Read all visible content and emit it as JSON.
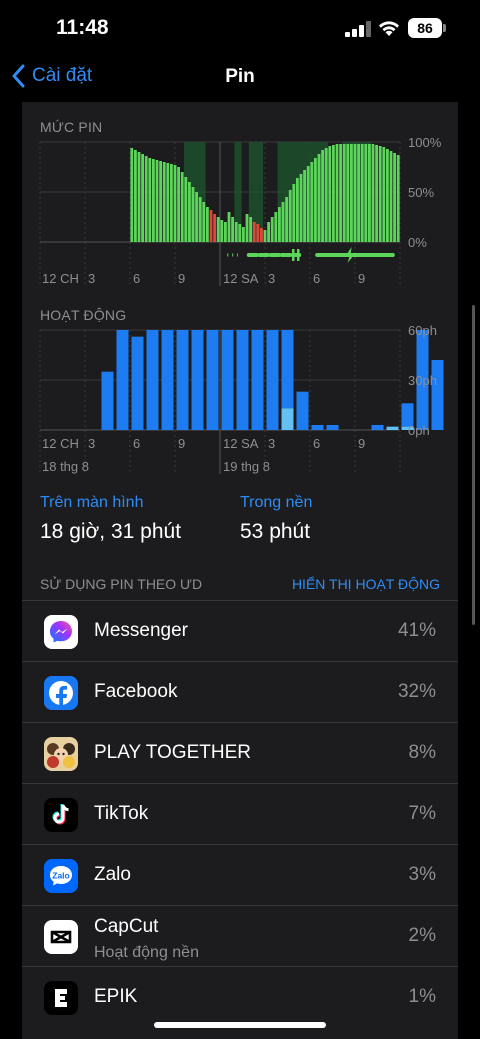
{
  "status": {
    "time": "11:48",
    "battery": "86"
  },
  "nav": {
    "back_label": "Cài đặt",
    "title": "Pin"
  },
  "battery_chart": {
    "section_label": "MỨC PIN",
    "y_ticks": [
      "100%",
      "50%",
      "0%"
    ],
    "x_ticks": [
      "12 CH",
      "3",
      "6",
      "9",
      "12 SA",
      "3",
      "6",
      "9"
    ]
  },
  "activity_chart": {
    "section_label": "HOẠT ĐỘNG",
    "y_ticks": [
      "60ph",
      "30ph",
      "0ph"
    ],
    "x_ticks": [
      "12 CH",
      "3",
      "6",
      "9",
      "12 SA",
      "3",
      "6",
      "9"
    ],
    "date_left": "18 thg 8",
    "date_right": "19 thg 8"
  },
  "chart_data": [
    {
      "type": "bar",
      "title": "MỨC PIN",
      "ylim": [
        0,
        100
      ],
      "y_ticks": [
        "100%",
        "50%",
        "0%"
      ],
      "x_ticks": [
        "12 CH",
        "3",
        "6",
        "9",
        "12 SA",
        "3",
        "6",
        "9"
      ],
      "values": [
        0,
        0,
        0,
        0,
        0,
        0,
        0,
        0,
        0,
        0,
        0,
        0,
        0,
        0,
        0,
        0,
        0,
        0,
        0,
        0,
        0,
        0,
        0,
        0,
        0,
        94,
        92,
        90,
        88,
        86,
        84,
        83,
        82,
        81,
        80,
        79,
        78,
        77,
        75,
        70,
        65,
        60,
        55,
        50,
        45,
        40,
        35,
        32,
        28,
        25,
        22,
        20,
        30,
        25,
        20,
        18,
        15,
        28,
        25,
        20,
        18,
        14,
        12,
        20,
        25,
        30,
        35,
        40,
        45,
        52,
        58,
        64,
        68,
        72,
        76,
        80,
        84,
        88,
        92,
        94,
        96,
        97,
        98,
        98,
        98,
        98,
        98,
        98,
        98,
        98,
        98,
        98,
        98,
        97,
        96,
        95,
        93,
        91,
        89,
        87
      ],
      "red_indices": [
        47,
        48,
        59,
        60,
        61
      ],
      "dark_green_bands": [
        [
          40,
          46
        ],
        [
          54,
          56
        ],
        [
          58,
          62
        ],
        [
          66,
          80
        ],
        [
          84,
          92
        ]
      ],
      "charging_band": [
        52,
        98
      ]
    },
    {
      "type": "bar",
      "title": "HOẠT ĐỘNG",
      "ylim": [
        0,
        60
      ],
      "y_ticks": [
        "60ph",
        "30ph",
        "0ph"
      ],
      "x_ticks": [
        "12 CH",
        "3",
        "6",
        "9",
        "12 SA",
        "3",
        "6",
        "9"
      ],
      "series": [
        {
          "name": "Trên màn hình",
          "values": [
            0,
            0,
            0,
            35,
            60,
            56,
            60,
            60,
            60,
            60,
            60,
            60,
            60,
            60,
            60,
            60,
            23,
            3,
            3,
            0,
            0,
            3,
            1,
            16,
            60,
            42
          ]
        },
        {
          "name": "Trong nền",
          "values": [
            0,
            0,
            0,
            0,
            0,
            0,
            0,
            0,
            0,
            0,
            0,
            0,
            0,
            0,
            0,
            13,
            0,
            0,
            0,
            0,
            0,
            0,
            2,
            2,
            0,
            0
          ]
        }
      ],
      "slot_positions": [
        -2,
        -1,
        0,
        1,
        2,
        3,
        4,
        5,
        6,
        7,
        8,
        9,
        10,
        11,
        12,
        13,
        14,
        15,
        16,
        17,
        18,
        19,
        20,
        21,
        22,
        23
      ]
    }
  ],
  "summary": {
    "screen_label": "Trên màn hình",
    "screen_value": "18 giờ, 31 phút",
    "background_label": "Trong nền",
    "background_value": "53 phút"
  },
  "usage": {
    "header": "SỬ DỤNG PIN THEO ƯD",
    "toggle": "HIỂN THỊ HOẠT ĐỘNG",
    "apps": [
      {
        "name": "Messenger",
        "percent": "41%"
      },
      {
        "name": "Facebook",
        "percent": "32%"
      },
      {
        "name": "PLAY TOGETHER",
        "percent": "8%"
      },
      {
        "name": "TikTok",
        "percent": "7%"
      },
      {
        "name": "Zalo",
        "percent": "3%"
      },
      {
        "name": "CapCut",
        "percent": "2%",
        "sub": "Hoạt động nền"
      },
      {
        "name": "EPIK",
        "percent": "1%"
      }
    ]
  },
  "colors": {
    "accent": "#2f8cf5",
    "battery_green": "#5dd55b",
    "battery_dark_green": "#1d5b2d",
    "battery_red": "#e0473b",
    "activity_blue": "#1e7cf2",
    "activity_light_blue": "#62c0f5"
  }
}
